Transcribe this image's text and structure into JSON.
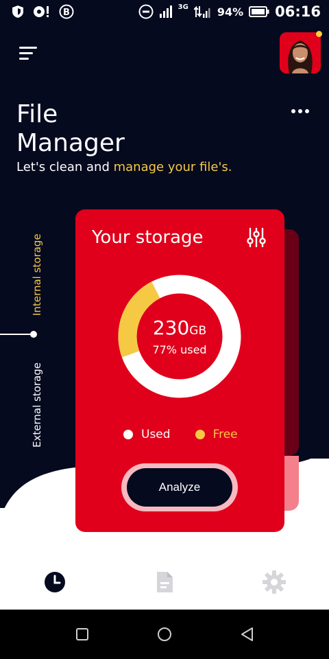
{
  "status_bar": {
    "battery_percent": "94%",
    "time": "06:16",
    "network_label": "3G",
    "icons_left": [
      "shield-icon",
      "notification-icon",
      "b-app-icon"
    ],
    "icons_right": [
      "dnd-icon",
      "signal-icon",
      "data-signal-icon",
      "battery-icon"
    ]
  },
  "header": {
    "title_line1": "File",
    "title_line2": "Manager",
    "subtitle_plain": "Let's clean and ",
    "subtitle_highlight": "manage your file's.",
    "menu_icon": "menu-icon",
    "more_icon": "more-options-icon"
  },
  "storage_tabs": {
    "internal": "Internal storage",
    "external": "External storage",
    "active": "internal"
  },
  "storage_card": {
    "title": "Your storage",
    "filter_icon": "sliders-icon",
    "total_value": "230",
    "total_unit": "GB",
    "used_label": "77% used",
    "free_fraction": 0.23,
    "legend": {
      "used": "Used",
      "free": "Free"
    },
    "analyze_label": "Analyze"
  },
  "bottom_nav": {
    "items": [
      "clock-icon",
      "document-icon",
      "gear-icon"
    ],
    "active": "clock-icon"
  },
  "colors": {
    "background_dark": "#050a1f",
    "card_red": "#e0001b",
    "accent_yellow": "#f6c945",
    "white": "#ffffff"
  }
}
